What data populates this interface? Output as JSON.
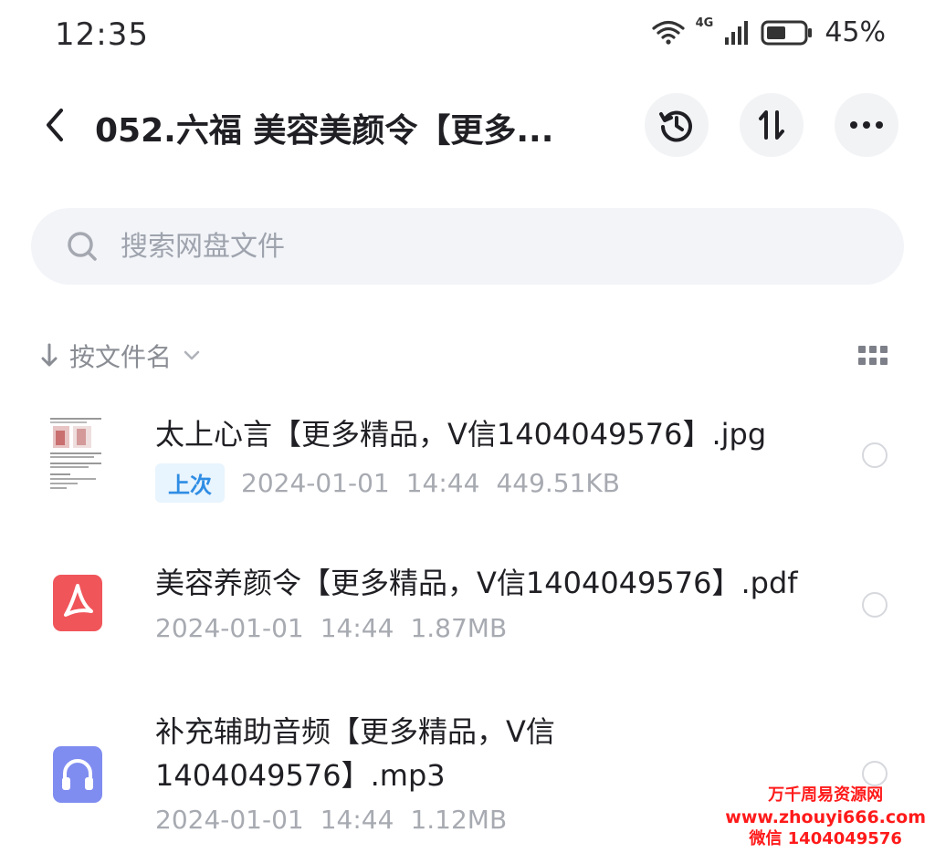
{
  "status_bar": {
    "time": "12:35",
    "network": "4G",
    "battery": "45%"
  },
  "header": {
    "title": "052.六福 美容美颜令【更多..."
  },
  "search": {
    "placeholder": "搜索网盘文件"
  },
  "sort": {
    "label": "按文件名"
  },
  "files": [
    {
      "name": "太上心言【更多精品，V信1404049576】.jpg",
      "badge": "上次",
      "date": "2024-01-01",
      "time": "14:44",
      "size": "449.51KB",
      "icon": "image-thumbnail"
    },
    {
      "name": "美容养颜令【更多精品，V信1404049576】.pdf",
      "date": "2024-01-01",
      "time": "14:44",
      "size": "1.87MB",
      "icon": "pdf-icon"
    },
    {
      "name_line1": "补充辅助音频【更多精品，V信",
      "name_line2": "1404049576】.mp3",
      "date": "2024-01-01",
      "time": "14:44",
      "size": "1.12MB",
      "icon": "audio-icon"
    }
  ],
  "watermark": {
    "line1": "万千周易资源网",
    "line2": "www.zhouyi666.com",
    "line3": "微信 1404049576"
  },
  "colors": {
    "pdf": "#f0555a",
    "audio": "#7f8cf0",
    "badge_text": "#2f8de4",
    "watermark": "#ff1a1a"
  }
}
